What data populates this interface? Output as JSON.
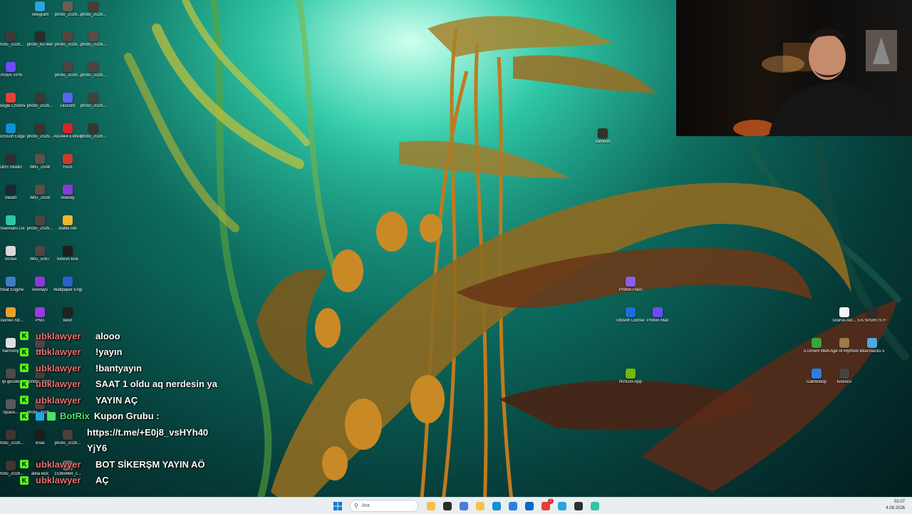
{
  "desktop": {
    "icons": [
      {
        "label": "Telegram",
        "color": "#2aa3e0",
        "icon": "telegram-icon"
      },
      {
        "label": "photo_2026...",
        "color": "#6b5d58",
        "icon": "photo-icon"
      },
      {
        "label": "photo_2026...",
        "color": "#4a3d35",
        "icon": "photo-icon"
      },
      {
        "label": "photo_2026...",
        "color": "#3d3a38",
        "icon": "photo-icon"
      },
      {
        "label": "photo_bu tekr",
        "color": "#2b2b2b",
        "icon": "photo-icon"
      },
      {
        "label": "photo_2026...",
        "color": "#54453e",
        "icon": "photo-icon"
      },
      {
        "label": "photo_2026...",
        "color": "#5a4d49",
        "icon": "photo-icon"
      },
      {
        "label": "Proton VPN",
        "color": "#6d4aff",
        "icon": "vpn-icon"
      },
      {
        "label": "photo_2026...",
        "color": "#4d4342",
        "icon": "photo-icon"
      },
      {
        "label": "photo_2026...",
        "color": "#51423f",
        "icon": "photo-icon"
      },
      {
        "label": "Google Chrome",
        "color": "#e34133",
        "icon": "chrome-icon"
      },
      {
        "label": "photo_2026...",
        "color": "#3d3836",
        "icon": "photo-icon"
      },
      {
        "label": "Discord",
        "color": "#5865f2",
        "icon": "discord-icon"
      },
      {
        "label": "photo_2026...",
        "color": "#4a3e3a",
        "icon": "photo-icon"
      },
      {
        "label": "Microsoft Edge",
        "color": "#0f8fd4",
        "icon": "edge-icon"
      },
      {
        "label": "photo_2026...",
        "color": "#3c3431",
        "icon": "photo-icon"
      },
      {
        "label": "AIDA64 Extreme",
        "color": "#d5242b",
        "icon": "aida-icon"
      },
      {
        "label": "photo_2026...",
        "color": "#3b3532",
        "icon": "photo-icon"
      },
      {
        "label": "OBS Studio",
        "color": "#2f2f33",
        "icon": "obs-icon"
      },
      {
        "label": "IMG_2504",
        "color": "#5b524c",
        "icon": "photo-icon"
      },
      {
        "label": "Rust",
        "color": "#c93d2a",
        "icon": "rust-icon"
      },
      {
        "label": "Steam",
        "color": "#1b2838",
        "icon": "steam-icon"
      },
      {
        "label": "IMG_2558",
        "color": "#5a4e47",
        "icon": "photo-icon"
      },
      {
        "label": "overlay",
        "color": "#8b3ad6",
        "icon": "folder-icon"
      },
      {
        "label": "Streamlabs Desktop",
        "color": "#31c3a2",
        "icon": "streamlabs-icon"
      },
      {
        "label": "photo_2026...",
        "color": "#4e4543",
        "icon": "photo-icon"
      },
      {
        "label": "Battle.net",
        "color": "#f2b531",
        "icon": "battlenet-icon"
      },
      {
        "label": "Vortex",
        "color": "#d9d9d9",
        "icon": "vortex-icon"
      },
      {
        "label": "IMG_5067",
        "color": "#4f4741",
        "icon": "photo-icon"
      },
      {
        "label": "turkish kick",
        "color": "#1e1e1e",
        "icon": "photo-icon"
      },
      {
        "label": "Cheat Engine",
        "color": "#3e7bc5",
        "icon": "cheatengine-icon"
      },
      {
        "label": "overlays",
        "color": "#8b3ad6",
        "icon": "folder-icon"
      },
      {
        "label": "Wallpaper Engine",
        "color": "#2a62c9",
        "icon": "wallpaper-icon"
      },
      {
        "label": "Counter-Str...",
        "color": "#e6a02e",
        "icon": "cs-icon"
      },
      {
        "label": "PNG",
        "color": "#9a3be0",
        "icon": "folder-icon"
      },
      {
        "label": "kesit",
        "color": "#222",
        "icon": "file-icon"
      },
      {
        "label": "harmony",
        "color": "#dfdfdf",
        "icon": "file-icon"
      },
      {
        "label": "IMG",
        "color": "#4b4440",
        "icon": "photo-icon"
      },
      {
        "label": "iyi gecele",
        "color": "#4e4a44",
        "icon": "photo-icon"
      },
      {
        "label": "photo_2026",
        "color": "#463c38",
        "icon": "photo-icon"
      },
      {
        "label": "Space...",
        "color": "#5a5a5a",
        "icon": "game-icon"
      },
      {
        "label": "photo_2026...",
        "color": "#4b403c",
        "icon": "photo-icon"
      },
      {
        "label": "photo_2026...",
        "color": "#3f3633",
        "icon": "photo-icon"
      },
      {
        "label": "insta",
        "color": "#1d1d1d",
        "icon": "photo-icon"
      },
      {
        "label": "photo_2026...",
        "color": "#4b403c",
        "icon": "photo-icon"
      },
      {
        "label": "photo_2026...",
        "color": "#3f3633",
        "icon": "photo-icon"
      },
      {
        "label": "atilla kick",
        "color": "#1d1d1d",
        "icon": "photo-icon"
      },
      {
        "label": "1536x864_c...",
        "color": "#6a6a6a",
        "icon": "photo-icon"
      },
      {
        "label": "Valheim",
        "color": "#34302a",
        "icon": "valheim-icon"
      },
      {
        "label": "Proton Pass",
        "color": "#8b5cf6",
        "icon": "protonpass-icon"
      },
      {
        "label": "Ubisoft Connect",
        "color": "#1f6ae0",
        "icon": "ubisoft-icon"
      },
      {
        "label": "Proton Mail",
        "color": "#6d4aff",
        "icon": "protonmail-icon"
      },
      {
        "label": "NVIDIA App",
        "color": "#76b900",
        "icon": "nvidia-icon"
      },
      {
        "label": "source-rec...",
        "color": "#f2f2f2",
        "icon": "record-icon"
      },
      {
        "label": "EA SPORTS FC™ 26",
        "color": "#2d2d2d",
        "icon": "eafc-icon"
      },
      {
        "label": "uTorrent Web",
        "color": "#36a73a",
        "icon": "utorrent-icon"
      },
      {
        "label": "Age of Mytholo...",
        "color": "#9b7a45",
        "icon": "aom-icon"
      },
      {
        "label": "BlueStacks 5",
        "color": "#4fa7e8",
        "icon": "bluestacks-icon"
      },
      {
        "label": "Gameloop",
        "color": "#2a7fe0",
        "icon": "gameloop-icon"
      },
      {
        "label": "lucescu",
        "color": "#444",
        "icon": "file-icon"
      }
    ]
  },
  "chat": {
    "badge": "K",
    "messages": [
      {
        "user": "ubklawyer",
        "text": "alooo"
      },
      {
        "user": "ubklawyer",
        "text": "!yayın"
      },
      {
        "user": "ubklawyer",
        "text": "!bantyayın"
      },
      {
        "user": "ubklawyer",
        "text": "SAAT 1 oldu aq nerdesin ya"
      },
      {
        "user": "ubklawyer",
        "text": "YAYIN AÇ"
      },
      {
        "user": "BotRix",
        "text": "Kupon Grubu :"
      },
      {
        "user": "",
        "text": "https://t.me/+E0j8_vsHYh40"
      },
      {
        "user": "",
        "text": "YjY6"
      },
      {
        "user": "ubklawyer",
        "text": "BOT SİKERŞM YAYIN AÖ"
      },
      {
        "user": "ubklawyer",
        "text": "AÇ"
      }
    ]
  },
  "taskbar": {
    "search_placeholder": "Ara",
    "apps": [
      {
        "icon": "explorer-icon",
        "color": "#f5c142"
      },
      {
        "icon": "terminal-icon",
        "color": "#2b2b2b"
      },
      {
        "icon": "photos-icon",
        "color": "#4a7cd9"
      },
      {
        "icon": "folder-icon",
        "color": "#f4c24a"
      },
      {
        "icon": "edge-icon",
        "color": "#0f8fd4"
      },
      {
        "icon": "store-icon",
        "color": "#2a7fe0"
      },
      {
        "icon": "outlook-icon",
        "color": "#0a64c9"
      },
      {
        "icon": "chrome-icon",
        "color": "#e34133"
      },
      {
        "icon": "telegram-icon",
        "color": "#2aa3e0"
      },
      {
        "icon": "obs-icon",
        "color": "#2f2f33"
      },
      {
        "icon": "streamlabs-icon",
        "color": "#31c3a2"
      }
    ],
    "chrome_badge": "7",
    "time": "02:07",
    "date": "4.08.2026"
  }
}
